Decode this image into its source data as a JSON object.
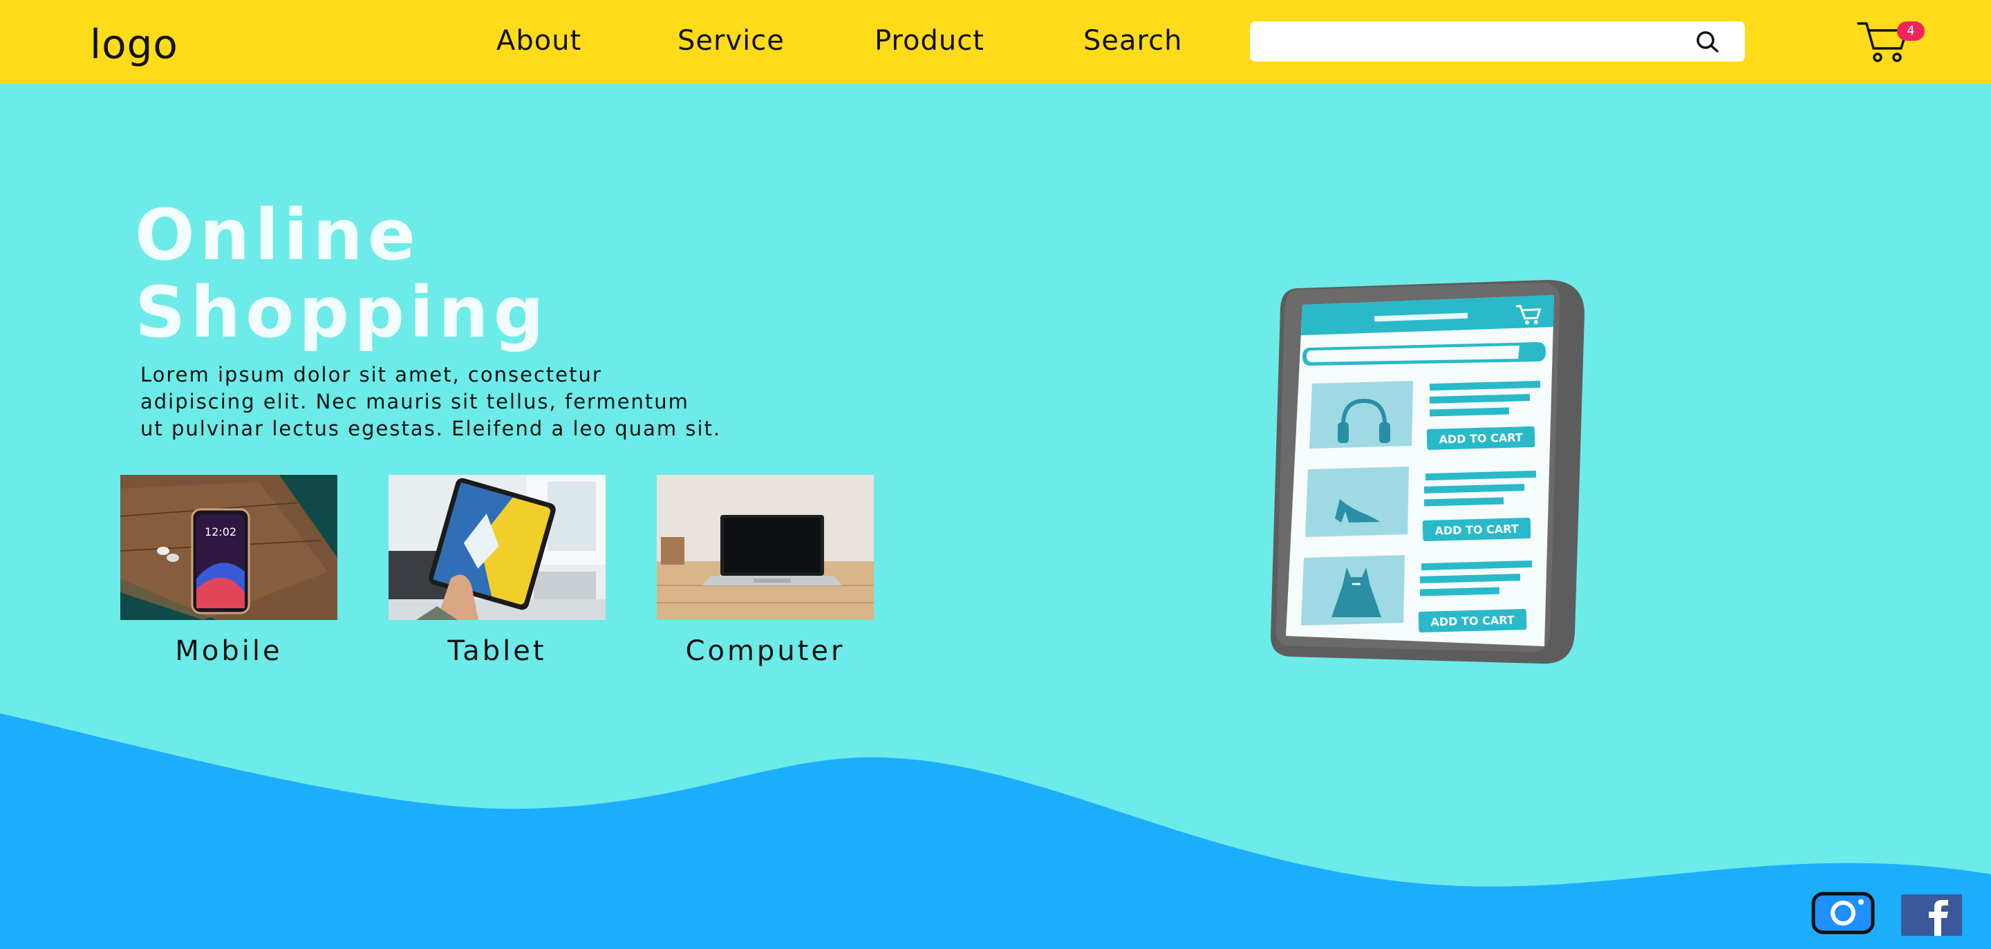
{
  "header": {
    "logo": "logo",
    "nav": [
      "About",
      "Service",
      "Product",
      "Search"
    ],
    "search_placeholder": "",
    "cart_count": "4"
  },
  "hero": {
    "title_line1": "Online",
    "title_line2": "Shopping",
    "description_lines": [
      "Lorem ipsum dolor sit amet, consectetur",
      "adipiscing elit. Nec mauris sit tellus, fermentum",
      "ut pulvinar lectus egestas. Eleifend a leo quam sit."
    ]
  },
  "categories": [
    {
      "label": "Mobile",
      "icon": "smartphone-photo"
    },
    {
      "label": "Tablet",
      "icon": "tablet-photo"
    },
    {
      "label": "Computer",
      "icon": "laptop-photo"
    }
  ],
  "illustration": {
    "button_label": "ADD TO CART",
    "products": [
      "headphones-icon",
      "high-heel-icon",
      "dress-icon"
    ]
  },
  "social": [
    "instagram-icon",
    "facebook-icon"
  ],
  "colors": {
    "header": "#ffdb1a",
    "hero_bg": "#6cebe8",
    "wave": "#1caefb",
    "accent": "#29b9c9",
    "badge": "#f0245a"
  }
}
